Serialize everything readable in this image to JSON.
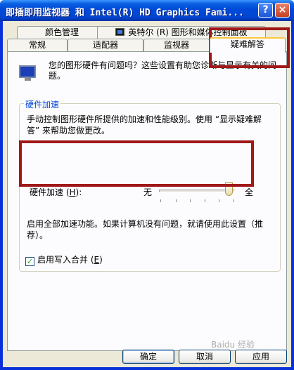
{
  "window": {
    "title": "即插即用监视器 和 Intel(R) HD Graphics Fami...",
    "help_label": "?",
    "close_label": "×"
  },
  "tabs": {
    "row1": [
      {
        "label": "颜色管理"
      },
      {
        "label": "英特尔 (R) 图形和媒体控制面板",
        "icon": "intel-graphics-icon"
      }
    ],
    "row2": [
      {
        "label": "常规"
      },
      {
        "label": "适配器"
      },
      {
        "label": "监视器"
      },
      {
        "label": "疑难解答",
        "active": true
      }
    ]
  },
  "intro": {
    "icon": "monitor-icon",
    "text": "您的图形硬件有问题吗？这些设置有助您诊断与显示有关的问题。"
  },
  "hardware_accel": {
    "legend": "硬件加速",
    "description": "手动控制图形硬件所提供的加速和性能级别。使用 “显示疑难解答” 来帮助您做更改。",
    "slider_label_prefix": "硬件加速 (",
    "slider_label_key": "H",
    "slider_label_suffix": "):",
    "min_label": "无",
    "max_label": "全",
    "slider_value": 1.0,
    "tick_count": 6,
    "level_description": "启用全部加速功能。如果计算机没有问题，就请使用此设置（推荐）。"
  },
  "write_combining": {
    "label_prefix": "启用写入合并 (",
    "label_key": "E",
    "label_suffix": ")",
    "checked": true
  },
  "buttons": {
    "ok": "确定",
    "cancel": "取消",
    "apply": "应用"
  },
  "watermark": "Baidu 经验",
  "colors": {
    "title_bar": "#0049d8",
    "dialog_bg": "#ece9d8",
    "legend_text": "#0046d5",
    "annotation": "#a01818"
  }
}
